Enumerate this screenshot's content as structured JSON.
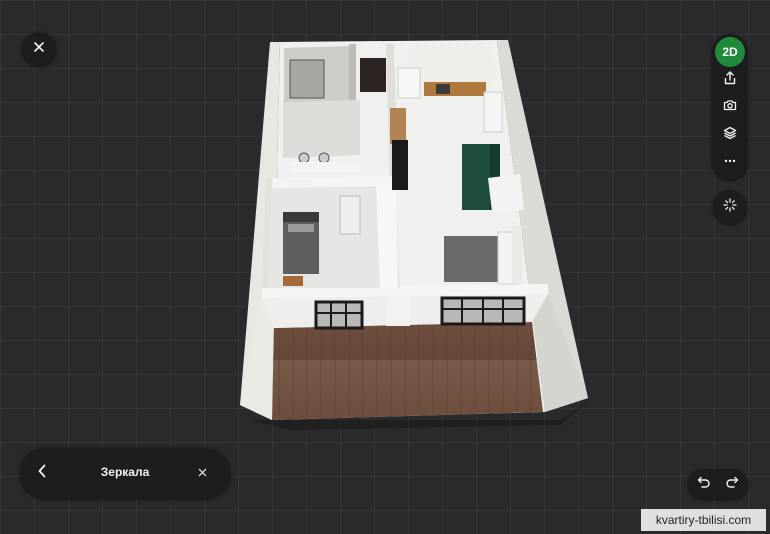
{
  "toolbar": {
    "view_mode_label": "2D",
    "icons": [
      "close-icon",
      "share-icon",
      "camera-icon",
      "layers-icon",
      "more-icon",
      "sparkle-icon"
    ]
  },
  "bottom_panel": {
    "title": "Зеркала",
    "icons": [
      "chevron-left-icon",
      "close-icon"
    ]
  },
  "history": {
    "icons": [
      "undo-icon",
      "redo-icon"
    ]
  },
  "watermark": "kvartiry-tbilisi.com",
  "colors": {
    "accent": "#1e8a3a",
    "panel": "#1d1d1f",
    "canvas": "#2a2a2c"
  }
}
